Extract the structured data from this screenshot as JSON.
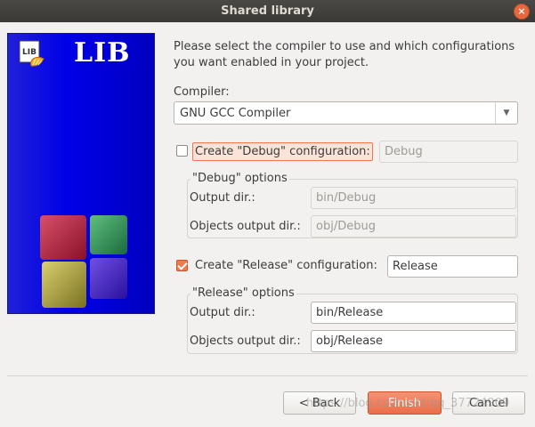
{
  "window": {
    "title": "Shared library",
    "close_icon": "×"
  },
  "banner": {
    "title": "LIB",
    "logo_icon": "lib-app-icon",
    "art": "codeblocks-cubes-logo"
  },
  "intro": {
    "line1": "Please select the compiler to use and which configurations",
    "line2": "you want enabled in your project."
  },
  "compiler": {
    "label": "Compiler:",
    "selected": "GNU GCC Compiler"
  },
  "debug": {
    "checkbox_label": "Create \"Debug\" configuration:",
    "checked": false,
    "name_value": "Debug",
    "group_title": "\"Debug\" options",
    "output_dir_label": "Output dir.:",
    "output_dir_value": "bin/Debug",
    "objects_dir_label": "Objects output dir.:",
    "objects_dir_value": "obj/Debug"
  },
  "release": {
    "checkbox_label": "Create \"Release\" configuration:",
    "checked": true,
    "name_value": "Release",
    "group_title": "\"Release\" options",
    "output_dir_label": "Output dir.:",
    "output_dir_value": "bin/Release",
    "objects_dir_label": "Objects output dir.:",
    "objects_dir_value": "obj/Release"
  },
  "buttons": {
    "back": "< Back",
    "finish": "Finish",
    "cancel": "Cancel"
  },
  "watermark": "https://blog.csdn.net/qq_37724909",
  "colors": {
    "accent": "#ef7a4e",
    "banner": "#0000e8",
    "titlebar": "#3c3b37"
  }
}
